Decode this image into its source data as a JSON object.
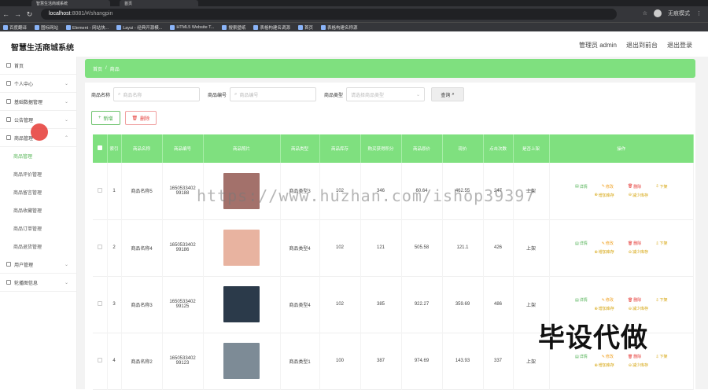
{
  "browser": {
    "tabs": [
      {
        "title": "智慧生活商城系统"
      },
      {
        "title": "首页"
      }
    ],
    "url_host": "localhost",
    "url_path": ":8081/#/shangpin",
    "profile_label": "无痕模式"
  },
  "bookmarks": [
    "百度翻译",
    "图标网站",
    "Element - 网站快...",
    "Layui - 经典开源模...",
    "HTML5 Website T...",
    "搜索壁纸",
    "表格构建名调源",
    "首页",
    "表格构建名称源"
  ],
  "app": {
    "title": "智慧生活商城系统",
    "admin_label": "管理员 admin",
    "back_front": "退出到前台",
    "logout": "退出登录"
  },
  "sidebar": {
    "items": [
      {
        "label": "首页",
        "icon": "home-icon",
        "chevron": false
      },
      {
        "label": "个人中心",
        "icon": "user-icon",
        "chevron": true
      },
      {
        "label": "基础数据管理",
        "icon": "data-icon",
        "chevron": true
      },
      {
        "label": "公告管理",
        "icon": "notice-icon",
        "chevron": true
      },
      {
        "label": "商品管理",
        "icon": "goods-icon",
        "chevron": true
      }
    ],
    "sub": [
      "商品管理",
      "商品评价管理",
      "商品留言管理",
      "商品收藏管理",
      "商品订单管理",
      "商品退货管理"
    ],
    "items_after": [
      {
        "label": "用户管理",
        "icon": "users-icon",
        "chevron": true
      },
      {
        "label": "轮播图信息",
        "icon": "carousel-icon",
        "chevron": true
      }
    ]
  },
  "breadcrumb": {
    "home": "首页",
    "sep": "/",
    "current": "商品"
  },
  "search": {
    "name_label": "商品名称",
    "name_placeholder": "商品名称",
    "code_label": "商品编号",
    "code_placeholder": "商品编号",
    "type_label": "商品类型",
    "type_placeholder": "请选择商品类型",
    "query_label": "查询"
  },
  "buttons": {
    "add": "新增",
    "del": "删除"
  },
  "table": {
    "headers": [
      "索引",
      "商品名称",
      "商品编号",
      "商品照片",
      "商品类型",
      "商品库存",
      "购买获得积分",
      "商品原价",
      "现价",
      "点击次数",
      "是否上架",
      "操作"
    ],
    "rows": [
      {
        "idx": "1",
        "name": "商品名称5",
        "code": "1650533402 99188",
        "type": "商品类型3",
        "stock": "102",
        "points": "346",
        "orig": "60.64",
        "price": "462.55",
        "clicks": "247",
        "status": "上架",
        "img": "#a3716b"
      },
      {
        "idx": "2",
        "name": "商品名称4",
        "code": "1650533402 99186",
        "type": "商品类型4",
        "stock": "102",
        "points": "121",
        "orig": "505.58",
        "price": "121.1",
        "clicks": "426",
        "status": "上架",
        "img": "#e8b3a0"
      },
      {
        "idx": "3",
        "name": "商品名称3",
        "code": "1650533402 99125",
        "type": "商品类型4",
        "stock": "102",
        "points": "385",
        "orig": "922.27",
        "price": "359.69",
        "clicks": "486",
        "status": "上架",
        "img": "#2b3a4a"
      },
      {
        "idx": "4",
        "name": "商品名称2",
        "code": "1650533402 99123",
        "type": "商品类型1",
        "stock": "100",
        "points": "387",
        "orig": "974.69",
        "price": "143.93",
        "clicks": "337",
        "status": "上架",
        "img": "#7d8b96"
      }
    ],
    "actions": {
      "detail": "详情",
      "edit": "修改",
      "delete": "删除",
      "off": "下架",
      "add_stock": "增加库存",
      "reduce_stock": "减少库存"
    }
  },
  "overlay": {
    "watermark": "https://www.huzhan.com/ishop39397",
    "big_text": "毕设代做"
  },
  "colors": {
    "accent": "#7fe07f",
    "primary_green": "#4caf50",
    "danger": "#e53935"
  }
}
